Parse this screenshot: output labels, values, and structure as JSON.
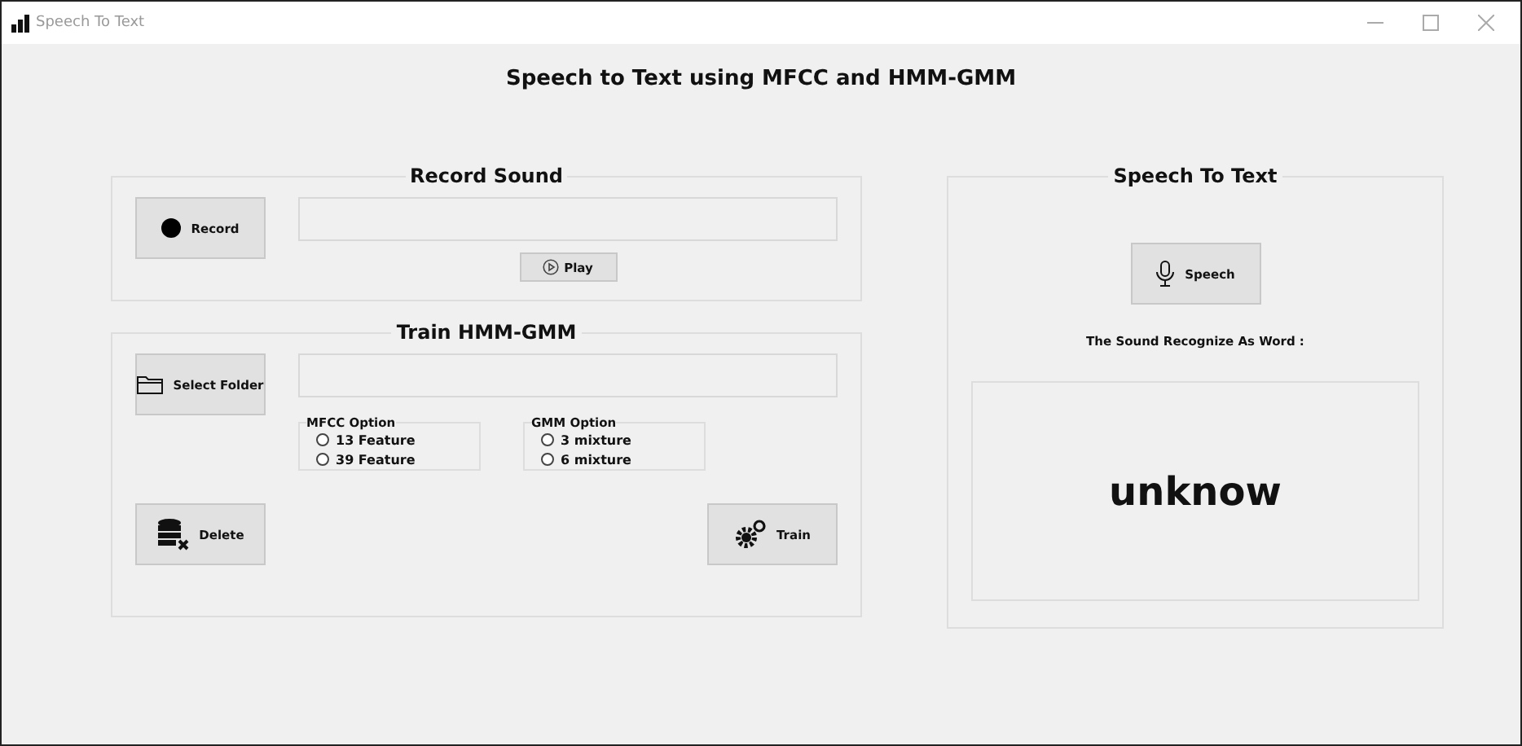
{
  "window": {
    "title": "Speech To Text"
  },
  "heading": "Speech to Text using MFCC and HMM-GMM",
  "record": {
    "title": "Record Sound",
    "record_button": "Record",
    "play_button": "Play"
  },
  "train": {
    "title": "Train HMM-GMM",
    "select_button": "Select Folder",
    "delete_button": "Delete",
    "train_button": "Train",
    "groups": [
      {
        "title": "MFCC Option",
        "options": [
          {
            "label": "13 Feature",
            "selected": false
          },
          {
            "label": "39 Feature",
            "selected": false
          }
        ]
      },
      {
        "title": "GMM Option",
        "options": [
          {
            "label": "3 mixture",
            "selected": false
          },
          {
            "label": "6 mixture",
            "selected": false
          }
        ]
      }
    ]
  },
  "speech": {
    "title": "Speech To Text",
    "speech_button": "Speech",
    "result_label": "The Sound Recognize As Word :",
    "result": "unknow"
  }
}
